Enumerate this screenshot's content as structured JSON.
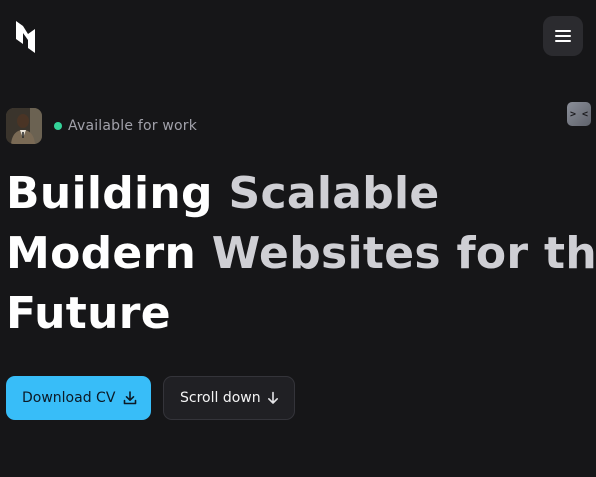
{
  "header": {
    "logo_icon": "logo-mark-icon",
    "menu_icon": "hamburger-menu-icon"
  },
  "hero": {
    "status_text": "Available for work",
    "status_color": "#34d399",
    "headline_lines": [
      {
        "strong": "Building ",
        "muted": "Scalable"
      },
      {
        "strong": "Modern ",
        "muted": "Websites for the"
      },
      {
        "strong": "Future",
        "muted": ""
      }
    ],
    "terminal_badge": "> <"
  },
  "actions": {
    "download_label": "Download CV",
    "download_icon": "download-icon",
    "scroll_label": "Scroll down",
    "scroll_icon": "arrow-down-icon",
    "accent_color": "#38bdf8"
  }
}
